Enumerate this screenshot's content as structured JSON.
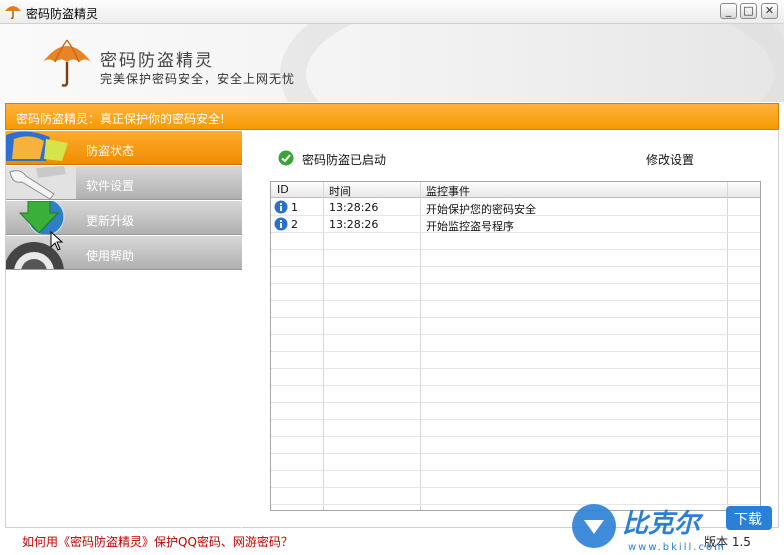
{
  "window": {
    "title": "密码防盗精灵",
    "buttons": {
      "minimize": "_",
      "maximize": "□",
      "close": "✕"
    }
  },
  "header": {
    "app_name": "密码防盗精灵",
    "slogan": "完美保护密码安全，安全上网无忧"
  },
  "notice": "密码防盗精灵：真正保护你的密码安全!",
  "sidebar": {
    "items": [
      {
        "label": "防盗状态",
        "icon": "shield-icon",
        "active": true
      },
      {
        "label": "软件设置",
        "icon": "wrench-icon",
        "active": false
      },
      {
        "label": "更新升级",
        "icon": "update-globe-icon",
        "active": false
      },
      {
        "label": "使用帮助",
        "icon": "help-lifebuoy-icon",
        "active": false
      }
    ]
  },
  "main": {
    "status_text": "密码防盗已启动",
    "settings_link": "修改设置",
    "table": {
      "columns": [
        "ID",
        "时间",
        "监控事件"
      ],
      "rows": [
        {
          "id": "1",
          "time": "13:28:26",
          "event": "开始保护您的密码安全"
        },
        {
          "id": "2",
          "time": "13:28:26",
          "event": "开始监控盗号程序"
        }
      ]
    }
  },
  "footer": {
    "help_link": "如何用《密码防盗精灵》保护QQ密码、网游密码？",
    "version": "版本 1.5"
  },
  "watermark": {
    "brand": "比克尔",
    "badge": "下载",
    "url": "www.bkill.com"
  },
  "colors": {
    "accent_orange": "#f59a00",
    "nav_gray": "#b8b8b8",
    "link_red": "#c00000",
    "status_green": "#3aa339",
    "info_blue": "#2a6fc9"
  }
}
